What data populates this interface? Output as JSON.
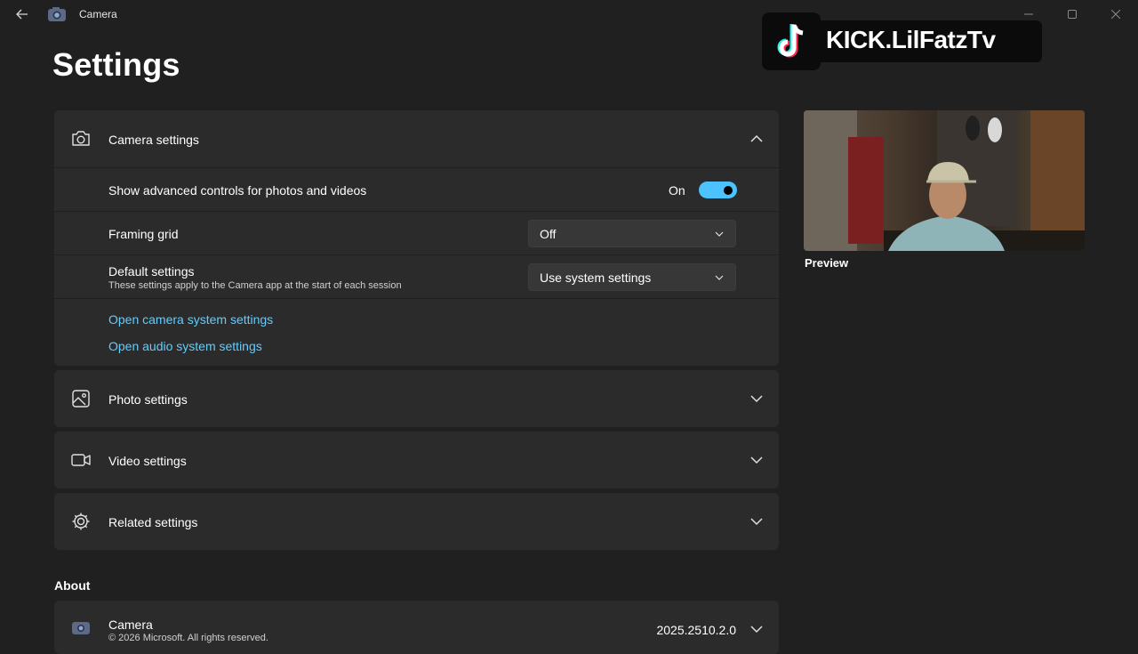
{
  "window": {
    "app_title": "Camera",
    "icons": {
      "back": "back-arrow-icon",
      "app": "camera-app-icon",
      "minimize": "minimize-icon",
      "maximize": "maximize-icon",
      "close": "close-icon"
    }
  },
  "page": {
    "title": "Settings"
  },
  "camera_settings": {
    "label": "Camera settings",
    "icon": "camera-icon",
    "expanded": true,
    "advanced_controls": {
      "label": "Show advanced controls for photos and videos",
      "state_text": "On",
      "enabled": true
    },
    "framing_grid": {
      "label": "Framing grid",
      "value": "Off"
    },
    "default_settings": {
      "label": "Default settings",
      "description": "These settings apply to the Camera app at the start of each session",
      "value": "Use system settings"
    },
    "links": [
      "Open camera system settings",
      "Open audio system settings"
    ]
  },
  "sections": [
    {
      "label": "Photo settings",
      "icon": "image-icon"
    },
    {
      "label": "Video settings",
      "icon": "video-icon"
    },
    {
      "label": "Related settings",
      "icon": "gear-icon"
    }
  ],
  "about": {
    "heading": "About",
    "app_name": "Camera",
    "copyright": "© 2026 Microsoft. All rights reserved.",
    "version": "2025.2510.2.0"
  },
  "preview": {
    "label": "Preview"
  },
  "overlay": {
    "text": "KICK.LilFatzTv",
    "icon": "tiktok-logo-icon"
  },
  "colors": {
    "accent": "#4cc2ff",
    "link": "#60cdff",
    "background": "#202020",
    "card": "#2b2b2b"
  }
}
